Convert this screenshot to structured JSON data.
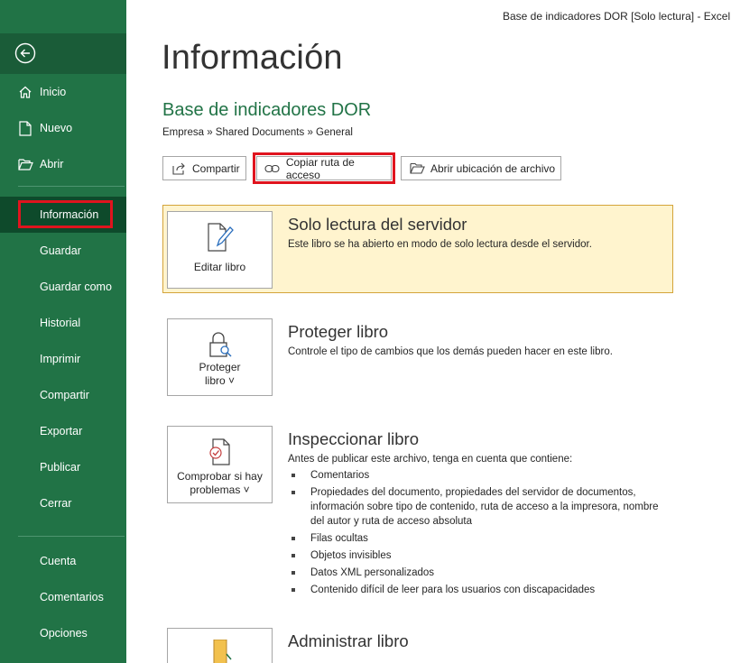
{
  "window": {
    "title": "Base de indicadores DOR  [Solo lectura]  -  Excel"
  },
  "sidebar": {
    "back_icon": "arrow-left-circle-icon",
    "items": [
      {
        "label": "Inicio",
        "icon": "home-icon"
      },
      {
        "label": "Nuevo",
        "icon": "new-document-icon"
      },
      {
        "label": "Abrir",
        "icon": "folder-open-icon"
      },
      {
        "label": "Información",
        "selected": true
      },
      {
        "label": "Guardar"
      },
      {
        "label": "Guardar como"
      },
      {
        "label": "Historial"
      },
      {
        "label": "Imprimir"
      },
      {
        "label": "Compartir"
      },
      {
        "label": "Exportar"
      },
      {
        "label": "Publicar"
      },
      {
        "label": "Cerrar"
      },
      {
        "label": "Cuenta"
      },
      {
        "label": "Comentarios"
      },
      {
        "label": "Opciones"
      }
    ]
  },
  "main": {
    "page_title": "Información",
    "doc_title": "Base de indicadores DOR",
    "breadcrumb": "Empresa » Shared Documents » General",
    "actions": [
      {
        "label": "Compartir",
        "icon": "share-icon"
      },
      {
        "label": "Copiar ruta de acceso",
        "icon": "link-icon",
        "highlighted": true
      },
      {
        "label": "Abrir ubicación de archivo",
        "icon": "folder-open-icon"
      }
    ],
    "server_readonly": {
      "tile_label": "Editar libro",
      "title": "Solo lectura del servidor",
      "description": "Este libro se ha abierto en modo de solo lectura desde el servidor."
    },
    "protect": {
      "tile_label_1": "Proteger",
      "tile_label_2": "libro ˅",
      "title": "Proteger libro",
      "description": "Controle el tipo de cambios que los demás pueden hacer en este libro."
    },
    "inspect": {
      "tile_label_1": "Comprobar si hay",
      "tile_label_2": "problemas ˅",
      "title": "Inspeccionar libro",
      "description": "Antes de publicar este archivo, tenga en cuenta que contiene:",
      "items": [
        "Comentarios",
        "Propiedades del documento, propiedades del servidor de documentos, información sobre tipo de contenido, ruta de acceso a la impresora, nombre del autor y ruta de acceso absoluta",
        "Filas ocultas",
        "Objetos invisibles",
        "Datos XML personalizados",
        "Contenido difícil de leer para los usuarios con discapacidades"
      ]
    },
    "manage": {
      "title": "Administrar libro"
    }
  },
  "colors": {
    "accent": "#217346",
    "selected": "#0e4a2b",
    "highlight": "#e0141e",
    "warning_bg": "#fff4ce"
  }
}
